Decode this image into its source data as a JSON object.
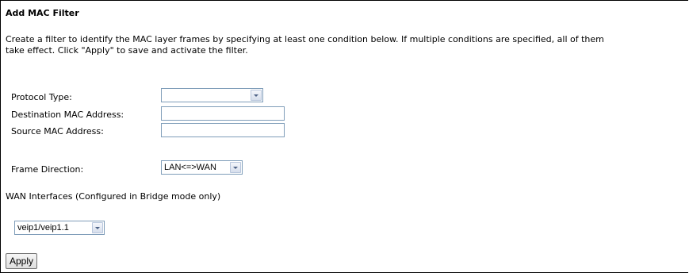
{
  "page": {
    "title": "Add MAC Filter",
    "description_line1": "Create a filter to identify the MAC layer frames by specifying at least one condition below. If multiple conditions are specified, all of them",
    "description_line2": "take effect. Click \"Apply\" to save and activate the filter."
  },
  "form": {
    "protocol_type_label": "Protocol Type:",
    "protocol_type_value": "",
    "destination_mac_label": "Destination MAC Address:",
    "destination_mac_value": "",
    "source_mac_label": "Source MAC Address:",
    "source_mac_value": "",
    "frame_direction_label": "Frame Direction:",
    "frame_direction_value": "LAN<=>WAN",
    "wan_interfaces_label": "WAN Interfaces (Configured in Bridge mode only)",
    "wan_interface_value": "veip1/veip1.1"
  },
  "actions": {
    "apply_label": "Apply"
  }
}
